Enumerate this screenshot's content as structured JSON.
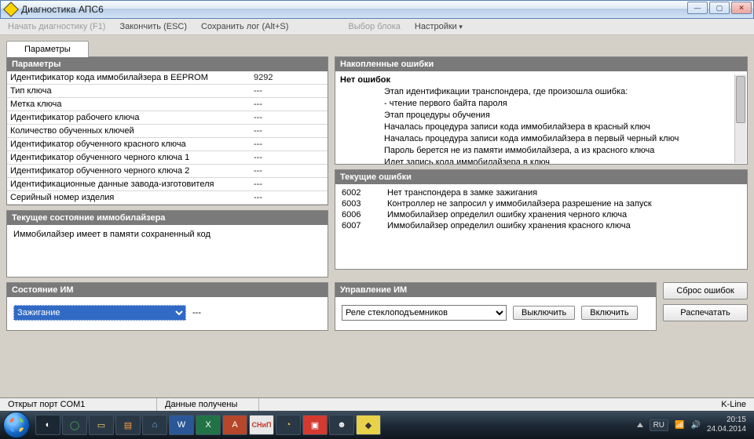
{
  "window": {
    "title": "Диагностика АПС6"
  },
  "menu": {
    "start": "Начать диагностику (F1)",
    "finish": "Закончить (ESC)",
    "savelog": "Сохранить лог (Alt+S)",
    "block": "Выбор блока",
    "settings": "Настройки"
  },
  "tabs": {
    "params": "Параметры"
  },
  "left_params": {
    "header": "Параметры",
    "rows": [
      {
        "k": "Идентификатор кода иммобилайзера в EEPROM",
        "v": "9292"
      },
      {
        "k": "Тип ключа",
        "v": "---"
      },
      {
        "k": "Метка ключа",
        "v": "---"
      },
      {
        "k": "Идентификатор рабочего ключа",
        "v": "---"
      },
      {
        "k": "Количество обученных ключей",
        "v": "---"
      },
      {
        "k": "Идентификатор обученного красного ключа",
        "v": "---"
      },
      {
        "k": "Идентификатор обученного черного ключа 1",
        "v": "---"
      },
      {
        "k": "Идентификатор обученного черного ключа 2",
        "v": "---"
      },
      {
        "k": "Идентификационные данные завода-изготовителя",
        "v": "---"
      },
      {
        "k": "Серийный номер изделия",
        "v": "---"
      }
    ]
  },
  "imm_state": {
    "header": "Текущее состояние иммобилайзера",
    "text": "Иммобилайзер имеет в памяти сохраненный код"
  },
  "accum_errors": {
    "header": "Накопленные ошибки",
    "no_err": "Нет ошибок",
    "lines": [
      "Этап идентификации транспондера, где произошла ошибка:",
      "- чтение первого байта пароля",
      "",
      "Этап процедуры обучения",
      "Началась процедура записи кода иммобилайзера в красный ключ",
      "Началась процедура записи кода иммобилайзера в первый черный ключ",
      "Пароль берется не из памяти иммобилайзера, а из красного ключа",
      "Идет запись кода иммобилайзера в ключ"
    ]
  },
  "cur_errors": {
    "header": "Текущие ошибки",
    "rows": [
      {
        "code": "6002",
        "text": "Нет транспондера в замке зажигания"
      },
      {
        "code": "6003",
        "text": "Контроллер не запросил у иммобилайзера разрешение на запуск"
      },
      {
        "code": "6006",
        "text": "Иммобилайзер определил ошибку хранения черного ключа"
      },
      {
        "code": "6007",
        "text": "Иммобилайзер определил ошибку хранения красного ключа"
      }
    ]
  },
  "im_state_ctrl": {
    "header": "Состояние ИМ",
    "selected": "Зажигание",
    "value": "---"
  },
  "im_manage": {
    "header": "Управление ИМ",
    "selected": "Реле стеклоподъемников",
    "btn_off": "Выключить",
    "btn_on": "Включить"
  },
  "side_buttons": {
    "reset": "Сброс ошибок",
    "print": "Распечатать"
  },
  "status": {
    "port": "Открыт порт COM1",
    "data": "Данные получены",
    "mode": "K-Line"
  },
  "tray": {
    "lang": "RU",
    "time": "20:15",
    "date": "24.04.2014"
  }
}
